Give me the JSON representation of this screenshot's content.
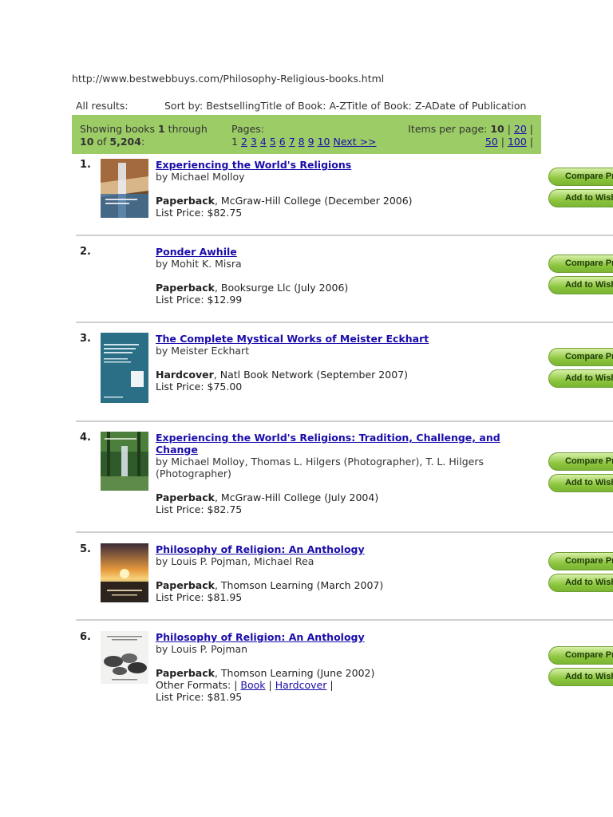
{
  "url": "http://www.bestwebbuys.com/Philosophy-Religious-books.html",
  "sortbar": {
    "all_results": "All results:",
    "sort_by": "Sort by: BestsellingTitle of Book: A-ZTitle of Book: Z-ADate of Publication"
  },
  "results_bar": {
    "showing_prefix": "Showing books ",
    "from": "1",
    "through": " through",
    "to": "10",
    "of": " of ",
    "total": "5,204",
    "colon": ":",
    "pages_label": "Pages:",
    "current_page": "1",
    "page_links": [
      "2",
      "3",
      "4",
      "5",
      "6",
      "7",
      "8",
      "9",
      "10"
    ],
    "next": "Next >>",
    "items_per_page_label": "Items per page: ",
    "items_current": "10",
    "items_options": [
      "20",
      "50",
      "100"
    ],
    "sep": " | "
  },
  "buttons": {
    "compare": "Compare Prices",
    "wishlist": "Add to Wish List"
  },
  "items": [
    {
      "num": "1.",
      "title": "Experiencing the World's Religions",
      "by": "by Michael Molloy",
      "format": "Paperback",
      "publisher": ", McGraw-Hill College (December 2006)",
      "price": "List Price: $82.75",
      "cover": "waterfall"
    },
    {
      "num": "2.",
      "title": "Ponder Awhile",
      "by": "by Mohit K. Misra",
      "format": "Paperback",
      "publisher": ", Booksurge Llc (July 2006)",
      "price": "List Price: $12.99",
      "cover": "none"
    },
    {
      "num": "3.",
      "title": "The Complete Mystical Works of Meister Eckhart",
      "by": "by Meister Eckhart",
      "format": "Hardcover",
      "publisher": ", Natl Book Network (September 2007)",
      "price": "List Price: $75.00",
      "cover": "teal"
    },
    {
      "num": "4.",
      "title": "Experiencing the World's Religions: Tradition, Challenge, and Change",
      "by": "by Michael Molloy, Thomas L. Hilgers (Photographer), T. L. Hilgers (Photographer)",
      "format": "Paperback",
      "publisher": ", McGraw-Hill College (July 2004)",
      "price": "List Price: $82.75",
      "cover": "forest"
    },
    {
      "num": "5.",
      "title": "Philosophy of Religion: An Anthology",
      "by": "by Louis P. Pojman, Michael Rea",
      "format": "Paperback",
      "publisher": ", Thomson Learning (March 2007)",
      "price": "List Price: $81.95",
      "cover": "sunset"
    },
    {
      "num": "6.",
      "title": "Philosophy of Religion: An Anthology",
      "by": "by Louis P. Pojman",
      "format": "Paperback",
      "publisher": ", Thomson Learning (June 2002)",
      "other_formats_label": "Other Formats: | ",
      "other_formats": [
        "Book",
        "Hardcover"
      ],
      "price": "List Price: $81.95",
      "cover": "stones"
    }
  ]
}
